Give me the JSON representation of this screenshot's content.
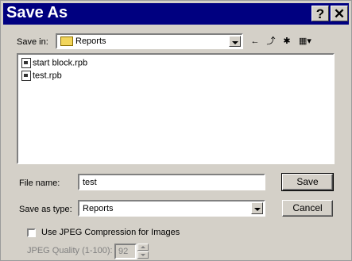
{
  "window": {
    "title": "Save As",
    "help_label": "?",
    "close_label": "✕"
  },
  "save_in": {
    "label": "Save in:",
    "value": "Reports"
  },
  "toolbar": {
    "back": "←",
    "up": "⤴",
    "new_folder": "✱",
    "view": "▦▾"
  },
  "files": [
    {
      "name": "start block.rpb"
    },
    {
      "name": "test.rpb"
    }
  ],
  "file_name": {
    "label": "File name:",
    "value": "test"
  },
  "save_type": {
    "label": "Save as type:",
    "value": "Reports"
  },
  "buttons": {
    "save": "Save",
    "cancel": "Cancel"
  },
  "jpeg": {
    "checkbox_label": "Use JPEG Compression for Images",
    "quality_label": "JPEG Quality (1-100):",
    "quality_value": "92"
  }
}
